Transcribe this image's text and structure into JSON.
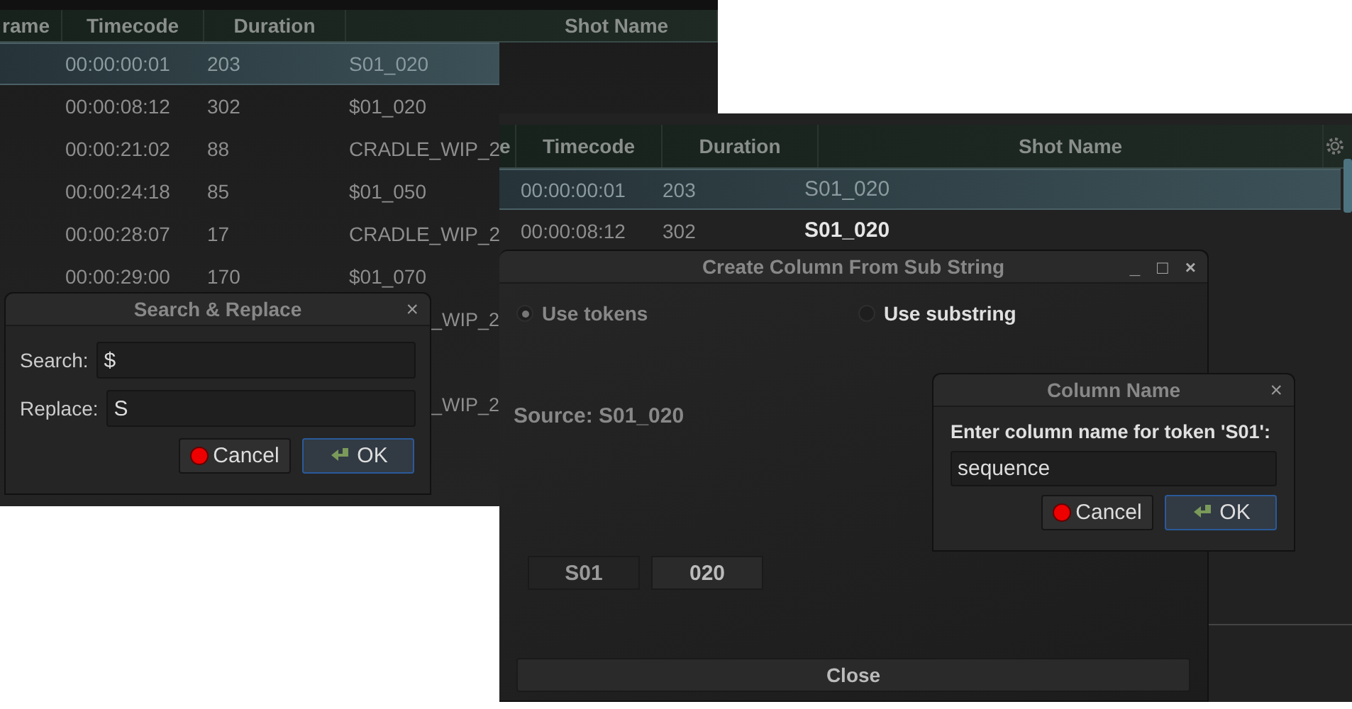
{
  "back_window": {
    "table": {
      "columns": [
        "rame",
        "Timecode",
        "Duration",
        "Shot Name"
      ],
      "rows": [
        {
          "timecode": "00:00:00:01",
          "duration": "203",
          "shot": "S01_020",
          "selected": true,
          "kind": "full"
        },
        {
          "timecode": "00:00:08:12",
          "duration": "302",
          "shot": "$01_020",
          "selected": false,
          "kind": "full"
        },
        {
          "timecode": "00:00:21:02",
          "duration": "88",
          "shot": "CRADLE_WIP_2",
          "selected": false,
          "kind": "full"
        },
        {
          "timecode": "00:00:24:18",
          "duration": "85",
          "shot": "$01_050",
          "selected": false,
          "kind": "full"
        },
        {
          "timecode": "00:00:28:07",
          "duration": "17",
          "shot": "CRADLE_WIP_2",
          "selected": false,
          "kind": "full"
        },
        {
          "timecode": "00:00:29:00",
          "duration": "170",
          "shot": "$01_070",
          "selected": false,
          "kind": "full"
        },
        {
          "shot": "_WIP_2",
          "selected": false,
          "kind": "partial"
        },
        {
          "shot": "_WIP_2",
          "selected": false,
          "kind": "partial"
        }
      ]
    },
    "dialog": {
      "title": "Search & Replace",
      "close": "×",
      "fields": [
        {
          "label": "Search:",
          "value": "$"
        },
        {
          "label": "Replace:",
          "value": "S"
        }
      ],
      "cancel": "Cancel",
      "ok": "OK"
    }
  },
  "front_window": {
    "table": {
      "columns": [
        "e",
        "Timecode",
        "Duration",
        "Shot Name"
      ],
      "rows": [
        {
          "timecode": "00:00:00:01",
          "duration": "203",
          "shot": "S01_020",
          "selected": true
        },
        {
          "timecode": "00:00:08:12",
          "duration": "302",
          "shot": "S01_020",
          "selected": false
        }
      ]
    },
    "dialog": {
      "title": "Create Column From Sub String",
      "controls": [
        "_",
        "□",
        "×"
      ],
      "options": [
        {
          "label": "Use tokens",
          "selected": true
        },
        {
          "label": "Use substring",
          "selected": false
        }
      ],
      "source": "Source: S01_020",
      "tokens": [
        "S01",
        "020"
      ],
      "close_button": "Close"
    },
    "prompt": {
      "title": "Column Name",
      "close": "×",
      "label": "Enter column name for token 'S01':",
      "value": "sequence",
      "cancel": "Cancel",
      "ok": "OK"
    }
  }
}
